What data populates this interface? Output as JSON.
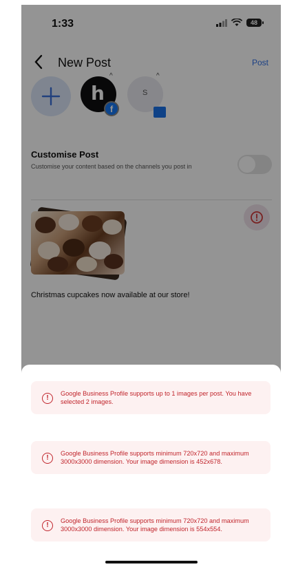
{
  "status_bar": {
    "time": "1:33",
    "battery": "48"
  },
  "navbar": {
    "title": "New Post",
    "post_label": "Post"
  },
  "channels": {
    "items": [
      {
        "letter": "h",
        "network_icon": "facebook-icon"
      },
      {
        "letter": "S",
        "network_icon": "google-business-icon"
      }
    ]
  },
  "customise": {
    "title": "Customise Post",
    "description": "Customise your content based on the channels you post in",
    "enabled": false
  },
  "post": {
    "caption": "Christmas cupcakes now available at our store!"
  },
  "alerts": [
    {
      "message": "Google Business Profile supports up to 1 images per post. You have selected 2 images."
    },
    {
      "message": "Google Business Profile supports minimum 720x720 and maximum 3000x3000 dimension. Your image dimension is 452x678."
    },
    {
      "message": "Google Business Profile supports minimum 720x720 and maximum 3000x3000 dimension. Your image dimension is 554x554."
    }
  ],
  "colors": {
    "accent": "#2f6fe4",
    "error": "#c0242b",
    "error_bg": "#fdf1f1"
  }
}
